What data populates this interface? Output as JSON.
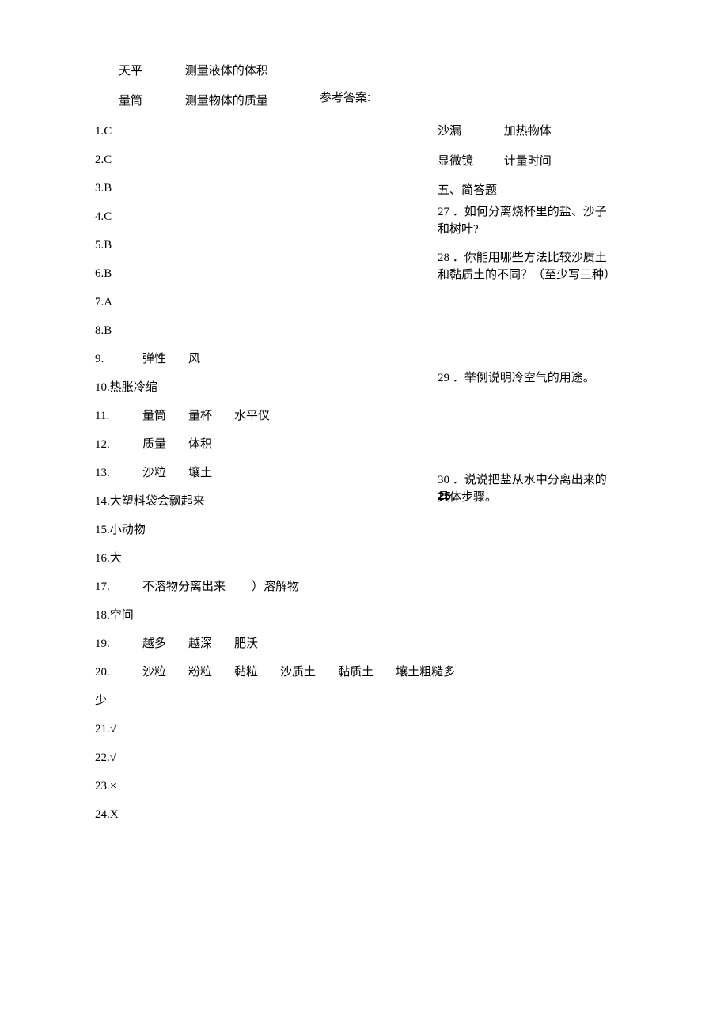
{
  "topLeft": {
    "row1": {
      "a": "天平",
      "b": "测量液体的体积"
    },
    "row2": {
      "a": "量筒",
      "b": "测量物体的质量"
    }
  },
  "refTitle": "参考答案:",
  "answers": [
    {
      "label": "1.C",
      "parts": []
    },
    {
      "label": "2.C",
      "parts": []
    },
    {
      "label": "3.B",
      "parts": []
    },
    {
      "label": "4.C",
      "parts": []
    },
    {
      "label": "5.B",
      "parts": []
    },
    {
      "label": "6.B",
      "parts": []
    },
    {
      "label": "7.A",
      "parts": []
    },
    {
      "label": "8.B",
      "parts": []
    },
    {
      "label": "9.",
      "parts": [
        "弹性",
        "风"
      ]
    },
    {
      "label": "10.热胀冷缩",
      "parts": []
    },
    {
      "label": "11.",
      "parts": [
        "量筒",
        "量杯",
        "水平仪"
      ]
    },
    {
      "label": "12.",
      "parts": [
        "质量",
        "体积"
      ]
    },
    {
      "label": "13.",
      "parts": [
        "沙粒",
        "壤土"
      ]
    },
    {
      "label": "14.大塑料袋会飘起来",
      "parts": []
    },
    {
      "label": "15.小动物",
      "parts": []
    },
    {
      "label": "16.大",
      "parts": []
    },
    {
      "label": "17.",
      "parts": [
        "不溶物分离出来",
        "）溶解物"
      ]
    },
    {
      "label": "18.空间",
      "parts": []
    },
    {
      "label": "19.",
      "parts": [
        "越多",
        "越深",
        "肥沃"
      ]
    },
    {
      "label": "20.",
      "parts": [
        "沙粒",
        "粉粒",
        "黏粒",
        "沙质土",
        "黏质土",
        "壤土粗糙多"
      ]
    },
    {
      "label": "少",
      "parts": []
    },
    {
      "label": "21.√",
      "parts": []
    },
    {
      "label": "22.√",
      "parts": []
    },
    {
      "label": "23.×",
      "parts": []
    },
    {
      "label": "24.X",
      "parts": []
    }
  ],
  "right": {
    "row1": {
      "a": "沙漏",
      "b": "加热物体"
    },
    "row2": {
      "a": "显微镜",
      "b": "计量时间"
    },
    "section": "五、简答题",
    "q27": "27 ．如何分离烧杯里的盐、沙子和树叶?",
    "q28": "28 ．你能用哪些方法比较沙质土和黏质土的不同？（至少写三种）",
    "q29": "29 ．举例说明冷空气的用途。",
    "q30": "30 ．说说把盐从水中分离出来的具体步骤。"
  },
  "inline25": "25．"
}
